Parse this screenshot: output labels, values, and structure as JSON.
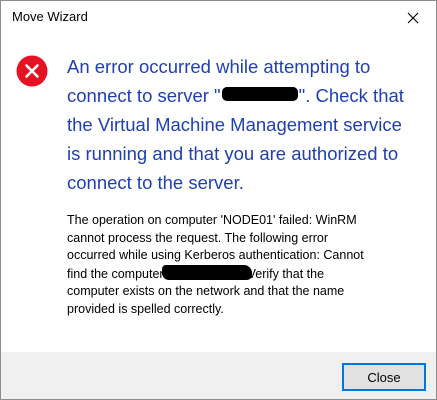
{
  "window": {
    "title": "Move Wizard"
  },
  "message": {
    "main_instruction": {
      "line1": "An error occurred while attempting to",
      "line2_before": "connect to server \"",
      "line2_after": "\". Check that",
      "line3": "the Virtual Machine Management service",
      "line4": "is running and that you are authorized to",
      "line5": "connect to the server."
    },
    "content": {
      "line1": "The operation on computer 'NODE01' failed: WinRM",
      "line2": "cannot process the request. The following error",
      "line3": "occurred while using Kerberos authentication: Cannot",
      "line4_before": "find the computer",
      "line4_after": "Verify that the",
      "line5": "computer exists on the network and that the name",
      "line6": "provided is spelled correctly."
    }
  },
  "buttons": {
    "close_label": "Close"
  },
  "colors": {
    "main_instruction": "#1f3fb3",
    "error_icon": "#e81123",
    "button_focus_border": "#0078d7",
    "footer_background": "#f0f0f0"
  },
  "icons": {
    "status": "error-icon",
    "titlebar_close": "close-icon"
  }
}
